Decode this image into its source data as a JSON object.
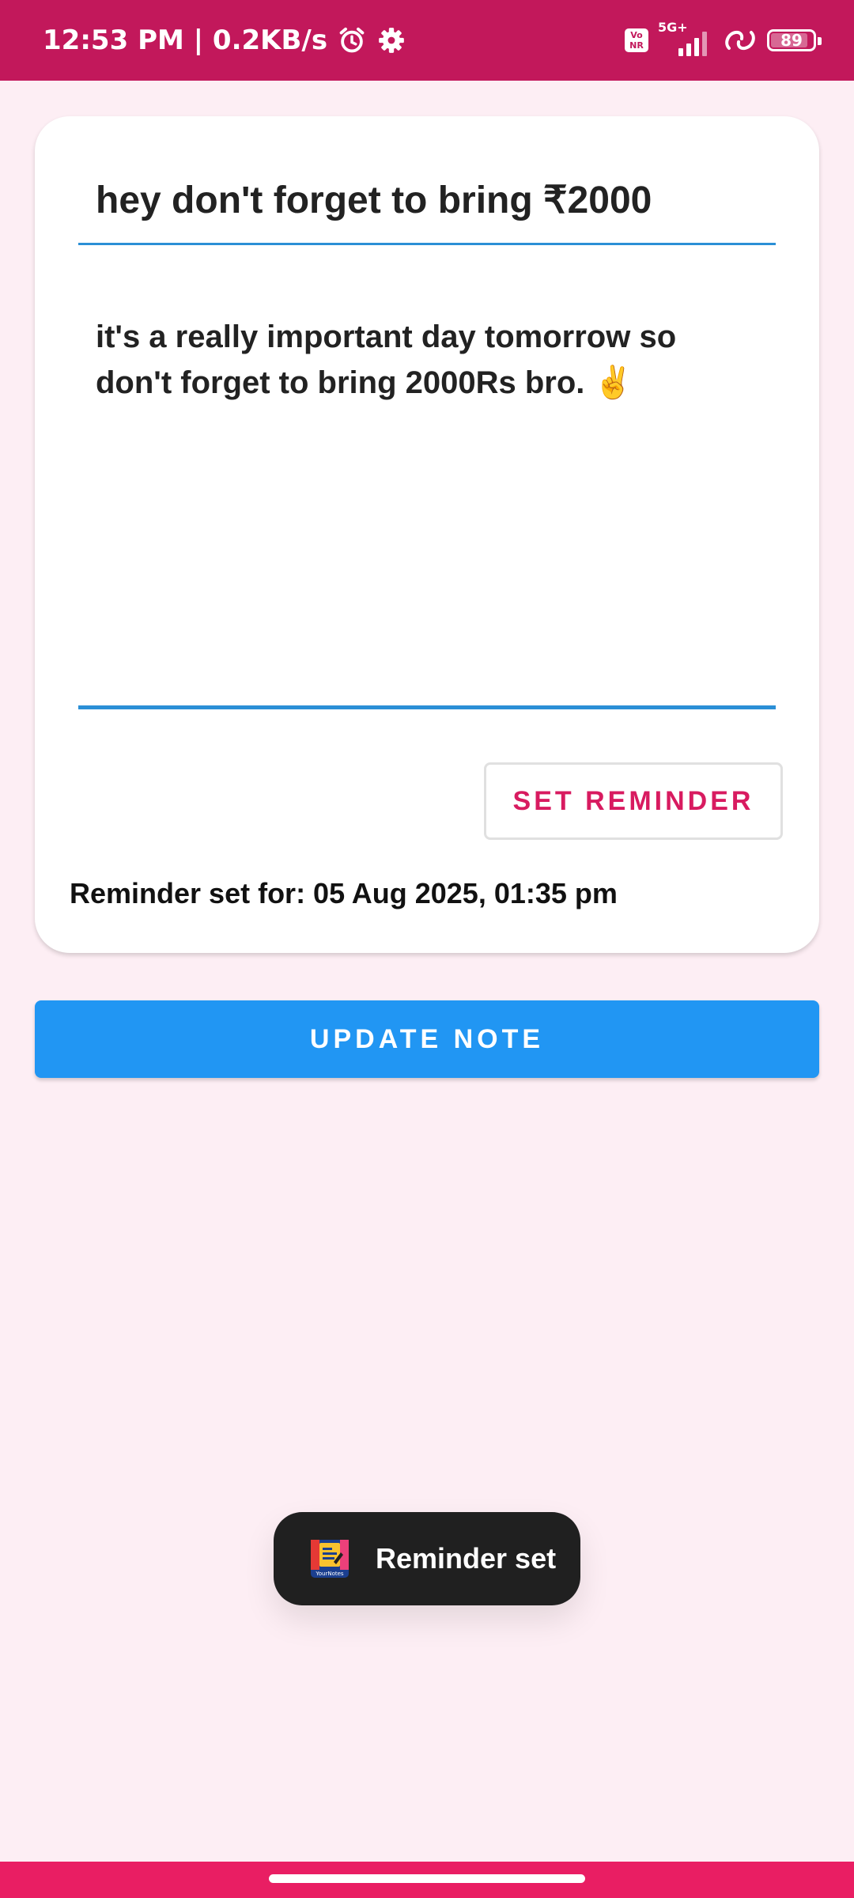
{
  "status_bar": {
    "time_speed": "12:53 PM | 0.2KB/s",
    "volte_label_top": "Vo",
    "volte_label_bottom": "NR",
    "network_label": "5G+",
    "battery_level": "89",
    "battery_fraction": 0.89,
    "icons": [
      "alarm-icon",
      "gear-icon",
      "volte-icon",
      "signal-icon",
      "link-icon",
      "battery-icon"
    ]
  },
  "note": {
    "title": "hey don't forget to bring ₹2000",
    "body": "it's a really important day tomorrow so don't forget to bring 2000Rs bro. ✌️"
  },
  "reminder": {
    "button_label": "SET REMINDER",
    "info": "Reminder set for: 05 Aug 2025, 01:35 pm"
  },
  "update_button_label": "UPDATE NOTE",
  "toast": {
    "icon_caption": "YourNotes",
    "message": "Reminder set"
  },
  "colors": {
    "status_bar": "#c2185b",
    "background": "#fdeef4",
    "accent_blue": "#2196f3",
    "underline_blue": "#2b8fd6",
    "reminder_pink": "#d81b60",
    "nav_bar": "#e91e63"
  }
}
